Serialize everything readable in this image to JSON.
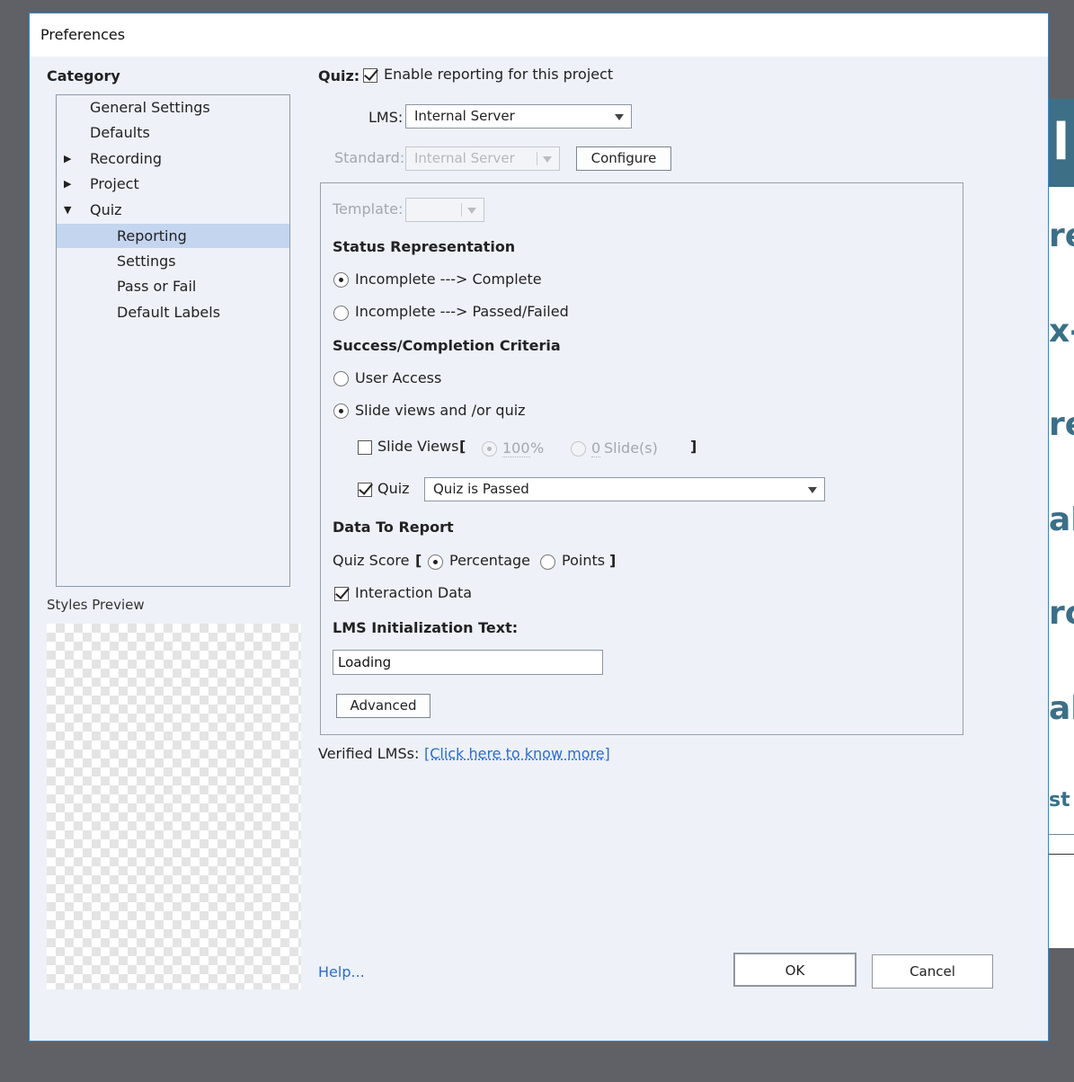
{
  "window": {
    "title": "Preferences"
  },
  "category": {
    "label": "Category",
    "items": [
      {
        "label": "General Settings",
        "level": 0,
        "arrow": ""
      },
      {
        "label": "Defaults",
        "level": 0,
        "arrow": ""
      },
      {
        "label": "Recording",
        "level": 0,
        "arrow": "▶"
      },
      {
        "label": "Project",
        "level": 0,
        "arrow": "▶"
      },
      {
        "label": "Quiz",
        "level": 0,
        "arrow": "▼"
      },
      {
        "label": "Reporting",
        "level": 1,
        "arrow": "",
        "selected": true
      },
      {
        "label": "Settings",
        "level": 1,
        "arrow": ""
      },
      {
        "label": "Pass or Fail",
        "level": 1,
        "arrow": ""
      },
      {
        "label": "Default Labels",
        "level": 1,
        "arrow": ""
      }
    ]
  },
  "styles_preview": {
    "label": "Styles Preview"
  },
  "quiz": {
    "label": "Quiz:",
    "enable_label": "Enable reporting for this project",
    "enabled": true
  },
  "lms": {
    "label": "LMS:",
    "value": "Internal Server"
  },
  "standard": {
    "label": "Standard:",
    "value": "Internal Server",
    "configure_label": "Configure"
  },
  "template": {
    "label": "Template:",
    "value": ""
  },
  "status": {
    "heading": "Status Representation",
    "options": [
      "Incomplete ---> Complete",
      "Incomplete ---> Passed/Failed"
    ],
    "selected": 0
  },
  "criteria": {
    "heading": "Success/Completion Criteria",
    "user_access_label": "User Access",
    "slide_views_quiz_label": "Slide views and /or quiz",
    "selected": "slide_views_quiz",
    "slide_views": {
      "label": "Slide Views",
      "checked": false,
      "open_bracket": "[",
      "close_bracket": "]",
      "percent_value": "100",
      "percent_unit": "%",
      "slides_value": "0",
      "slides_unit": "Slide(s)"
    },
    "quiz": {
      "label": "Quiz",
      "checked": true,
      "value": "Quiz is Passed"
    }
  },
  "data_report": {
    "heading": "Data To Report",
    "quiz_score_label": "Quiz Score",
    "open_bracket": "[",
    "close_bracket": "]",
    "percentage_label": "Percentage",
    "points_label": "Points",
    "score_selected": "percentage",
    "interaction_label": "Interaction Data",
    "interaction_checked": true
  },
  "lms_init": {
    "heading": "LMS Initialization Text:",
    "value": "Loading"
  },
  "advanced_label": "Advanced",
  "verified": {
    "label": "Verified LMSs:",
    "link": "[Click here to know more]"
  },
  "footer": {
    "help": "Help...",
    "ok": "OK",
    "cancel": "Cancel"
  },
  "background_fragments": [
    "l",
    "re",
    "x-",
    "re",
    "al",
    "rc",
    "al",
    "st l"
  ]
}
